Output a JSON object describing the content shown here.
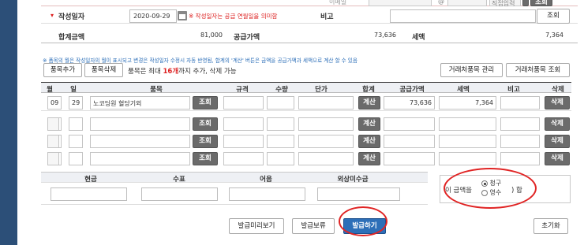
{
  "top": {
    "email_label": "이메일",
    "at": "@",
    "domain_select": "직접입력",
    "lookup": "조회"
  },
  "row1": {
    "marker": "▾",
    "issue_date_label": "작성일자",
    "issue_date": "2020-09-29",
    "calendar_icon": "calendar-icon",
    "issue_date_note": "※ 작성일자는 공급 연월일을 의미함",
    "remark_label": "비고",
    "remark_lookup": "조회"
  },
  "row2": {
    "total_label": "합계금액",
    "total": "81,000",
    "supply_label": "공급가액",
    "supply": "73,636",
    "tax_label": "세액",
    "tax": "7,364"
  },
  "notice": "※ 품목의 월은 작성일자의 월이 표시되고 변경은 작성일자 수정시 자동 반영됨, 합계의 '계산' 버튼은 금액을 공급가액과 세액으로 계산 할 수 있음",
  "item_toolbar": {
    "add": "품목추가",
    "delete": "품목삭제",
    "limit_pre": "품목은 최대 ",
    "limit_num": "16개",
    "limit_post": "까지 추가, 삭제 가능",
    "manage": "거래처품목 관리",
    "lookup": "거래처품목 조회"
  },
  "columns": {
    "month": "월",
    "day": "일",
    "item": "품목",
    "spec": "규격",
    "qty": "수량",
    "price": "단가",
    "sum": "합계",
    "supply": "공급가액",
    "tax": "세액",
    "remark": "비고",
    "delete": "삭제"
  },
  "rows": [
    {
      "month": "09",
      "day": "29",
      "item": "노코딩원 혈당기외",
      "lookup": "조회",
      "calc": "계산",
      "supply": "73,636",
      "tax": "7,364",
      "delete": "삭제"
    },
    {
      "month": "",
      "day": "",
      "item": "",
      "lookup": "조회",
      "calc": "계산",
      "supply": "",
      "tax": "",
      "delete": "삭제"
    },
    {
      "month": "",
      "day": "",
      "item": "",
      "lookup": "조회",
      "calc": "계산",
      "supply": "",
      "tax": "",
      "delete": "삭제"
    },
    {
      "month": "",
      "day": "",
      "item": "",
      "lookup": "조회",
      "calc": "계산",
      "supply": "",
      "tax": "",
      "delete": "삭제"
    }
  ],
  "payment": {
    "cash": "현금",
    "check": "수표",
    "note": "어음",
    "credit": "외상미수금"
  },
  "amount_type": {
    "prefix": "이 금액을",
    "claim": "청구",
    "receipt": "영수",
    "suffix": "함",
    "selected": "claim"
  },
  "actions": {
    "preview": "발급미리보기",
    "hold": "발급보류",
    "issue": "발급하기",
    "reset": "초기화"
  },
  "colors": {
    "sidebar": "#2c4f78",
    "primary": "#2d6fb8",
    "highlight": "#e02424",
    "dark_button": "#6b6b6b"
  }
}
